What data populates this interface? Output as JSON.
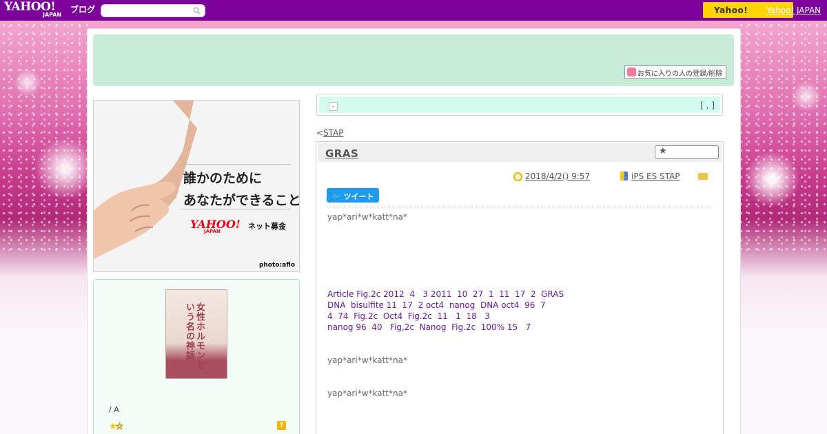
{
  "topbar": {
    "logo": "YAHOO!",
    "logo_sub": "JAPAN",
    "blog_label": "ブログ",
    "search_placeholder": "",
    "yahoo_button": "Yahoo!",
    "yahoo_japan_link": "Yahoo! JAPAN"
  },
  "header": {
    "fav_button": "お気に入りの人の登録/削除"
  },
  "ad": {
    "line1": "誰かのために",
    "line2": "あなたができること",
    "logo": "YAHOO!",
    "logo_sub": "JAPAN",
    "net_label": "ネット募金",
    "photo_credit": "photo:aflo"
  },
  "book": {
    "title": "女性ホルモンという名の神話",
    "author": "/ A",
    "rating_on": "★",
    "rating_off": "☆",
    "help": "?"
  },
  "nav": {
    "arrow": "›",
    "right": "[ , ]"
  },
  "prev": {
    "prefix": "<",
    "label": "STAP"
  },
  "article": {
    "title": "GRAS",
    "fav_star": "★",
    "date": "2018/4/2()  9:57",
    "category": "iPS ES STAP",
    "tweet": "ツイート",
    "author1": "yap*ari*w*katt*na*",
    "paragraph": "Article Fig.2c 2012  4   3 2011  10  27  1  11  17  2  GRAS\nDNA  bisulfite 11  17  2 oct4  nanog  DNA oct4  96  7\n4  74  Fig.2c  Oct4  Fig.2c  11   1  18   3\nnanog 96  40   Fig,2c  Nanog  Fig.2c  100% 15   7",
    "author2": "yap*ari*w*katt*na*",
    "author3": "yap*ari*w*katt*na*"
  },
  "colors": {
    "topbar": "#7b0099",
    "accent_yellow": "#ffd400",
    "header_band": "#c9ecda",
    "nav_band": "#d4fbf1",
    "link_purple": "#6a1a9a",
    "tweet_blue": "#1d9bf0"
  },
  "icons": [
    "search-icon",
    "heart-icon",
    "clock-icon",
    "book-icon",
    "folder-icon",
    "star-icon",
    "twitter-icon",
    "help-icon"
  ]
}
